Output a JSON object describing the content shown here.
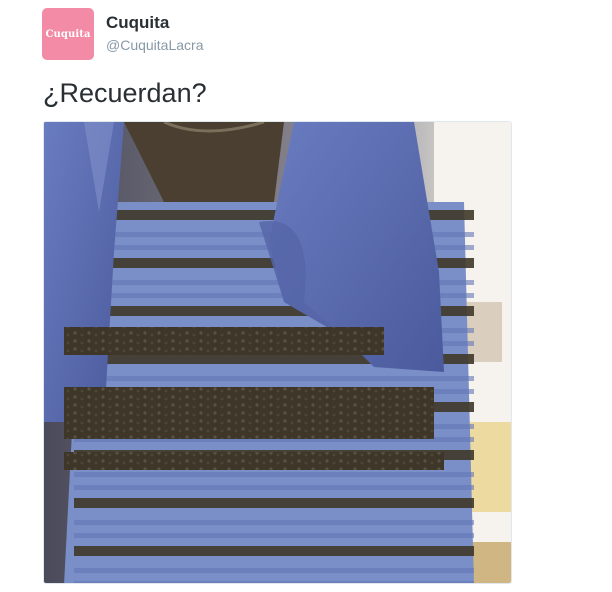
{
  "author": {
    "avatar_text": "Cuquita",
    "display_name": "Cuquita",
    "username": "@CuquitaLacra"
  },
  "tweet": {
    "text": "¿Recuerdan?"
  },
  "colors": {
    "avatar_bg": "#f48ba6",
    "name_text": "#292f33",
    "username_text": "#8899a6",
    "dress_blue": "#7c8fc6",
    "lace_black": "#3c3527",
    "jacket_blue": "#5d6fb3"
  }
}
